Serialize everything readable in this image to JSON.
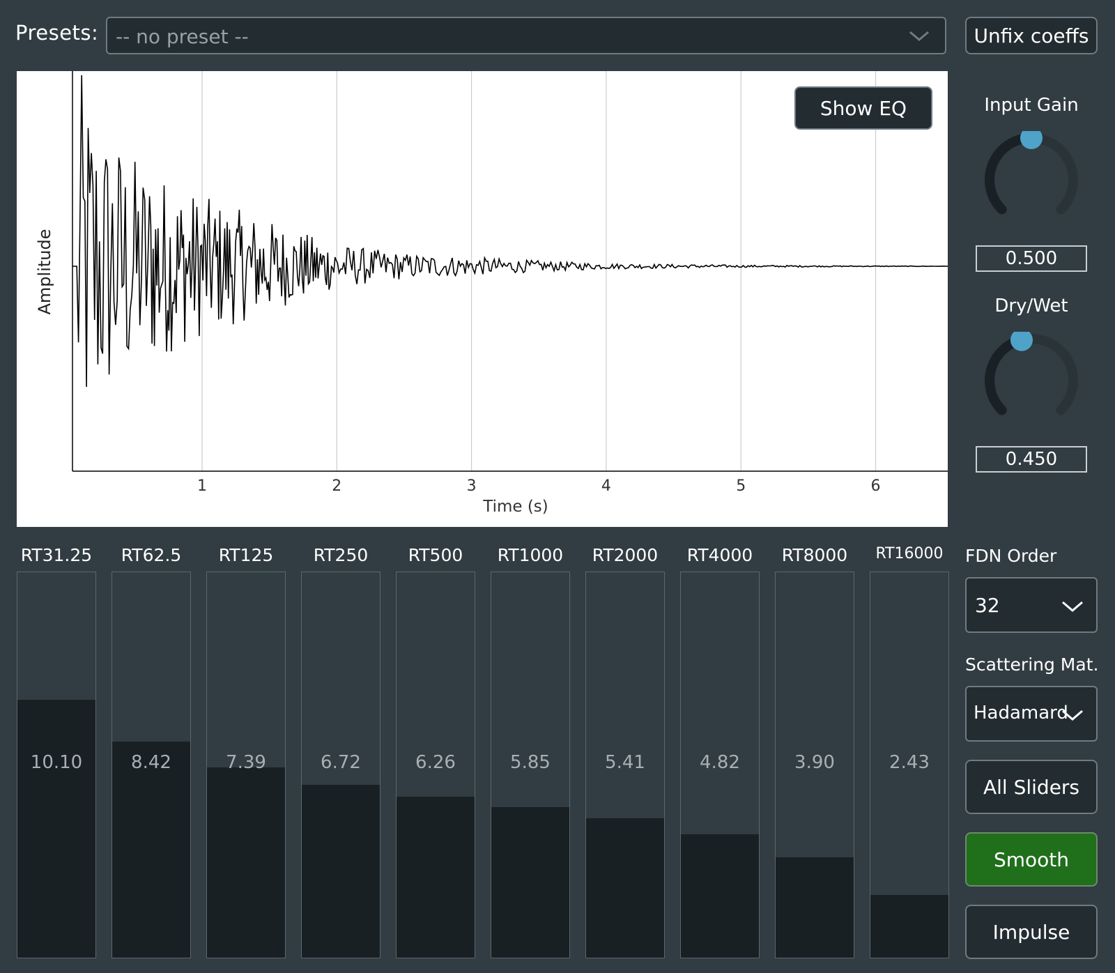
{
  "header": {
    "presets_label": "Presets:",
    "preset_value": "-- no preset --",
    "unfix_button": "Unfix coeffs"
  },
  "plot": {
    "show_eq_button": "Show EQ",
    "ylabel": "Amplitude",
    "xlabel": "Time (s)",
    "x_ticks": [
      "1",
      "2",
      "3",
      "4",
      "5",
      "6"
    ]
  },
  "chart_data": {
    "type": "line",
    "xlabel": "Time (s)",
    "ylabel": "Amplitude",
    "xlim": [
      -0.1,
      6.5
    ],
    "ylim": [
      -1,
      1
    ],
    "series": [
      {
        "values_note": "",
        "x": [
          0.08,
          0.12,
          0.2,
          0.3,
          0.45,
          0.6,
          0.8,
          1.0,
          1.3,
          1.6,
          2.0,
          2.5,
          3.0,
          3.5,
          4.0,
          5.0,
          6.0,
          6.5
        ],
        "envelope": [
          1.0,
          0.98,
          0.85,
          0.72,
          0.62,
          0.55,
          0.45,
          0.38,
          0.3,
          0.22,
          0.12,
          0.07,
          0.05,
          0.03,
          0.015,
          0.006,
          0.002,
          0.001
        ]
      }
    ]
  },
  "controls": {
    "input_gain_label": "Input Gain",
    "input_gain_value": "0.500",
    "input_gain_fraction": 0.5,
    "dry_wet_label": "Dry/Wet",
    "dry_wet_value": "0.450",
    "dry_wet_fraction": 0.45,
    "knob_accent": "#4fa3c9"
  },
  "sliders": [
    {
      "label": "RT31.25",
      "value": "10.10",
      "fraction": 0.67
    },
    {
      "label": "RT62.5",
      "value": "8.42",
      "fraction": 0.56
    },
    {
      "label": "RT125",
      "value": "7.39",
      "fraction": 0.493
    },
    {
      "label": "RT250",
      "value": "6.72",
      "fraction": 0.448
    },
    {
      "label": "RT500",
      "value": "6.26",
      "fraction": 0.417
    },
    {
      "label": "RT1000",
      "value": "5.85",
      "fraction": 0.39
    },
    {
      "label": "RT2000",
      "value": "5.41",
      "fraction": 0.361
    },
    {
      "label": "RT4000",
      "value": "4.82",
      "fraction": 0.321
    },
    {
      "label": "RT8000",
      "value": "3.90",
      "fraction": 0.26
    },
    {
      "label": "RT16000",
      "value": "2.43",
      "fraction": 0.162
    }
  ],
  "side": {
    "fdn_order_label": "FDN Order",
    "fdn_order_value": "32",
    "scattering_label": "Scattering Mat.",
    "scattering_value": "Hadamard",
    "all_sliders_button": "All Sliders",
    "smooth_button": "Smooth",
    "impulse_button": "Impulse",
    "smooth_color": "#1f6f1b"
  }
}
